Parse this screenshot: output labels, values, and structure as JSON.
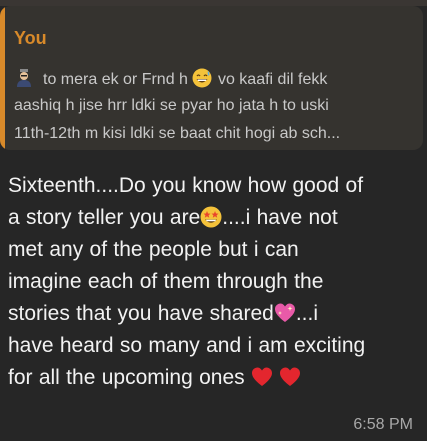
{
  "reply_quote": {
    "author": "You",
    "line1_before_emoji": "to mera ek or Frnd h",
    "line1_after_emoji": "vo kaafi dil fekk",
    "line2": "aashiq h jise hrr ldki se pyar ho jata h to uski",
    "line3": "11th-12th m kisi ldki se baat chit hogi ab sch..."
  },
  "message": {
    "line1": "Sixteenth....Do you know how good of",
    "line2_before": "a story teller you are",
    "line2_after": "....i have not",
    "line3": "met any of the people but i can",
    "line4": "imagine each of them through the",
    "line5_before": "stories that you have shared",
    "line5_after": "...i",
    "line6": "have heard so many and i am exciting",
    "line7": "for all the upcoming ones",
    "time": "6:58 PM"
  },
  "colors": {
    "accent": "#d88a2a",
    "background": "#262626",
    "quote_background": "#35332f",
    "text": "#f2f2f2"
  },
  "icons": [
    "person-icon",
    "grinning-sweat-icon",
    "star-struck-icon",
    "sparkling-heart-icon",
    "red-heart-icon"
  ]
}
